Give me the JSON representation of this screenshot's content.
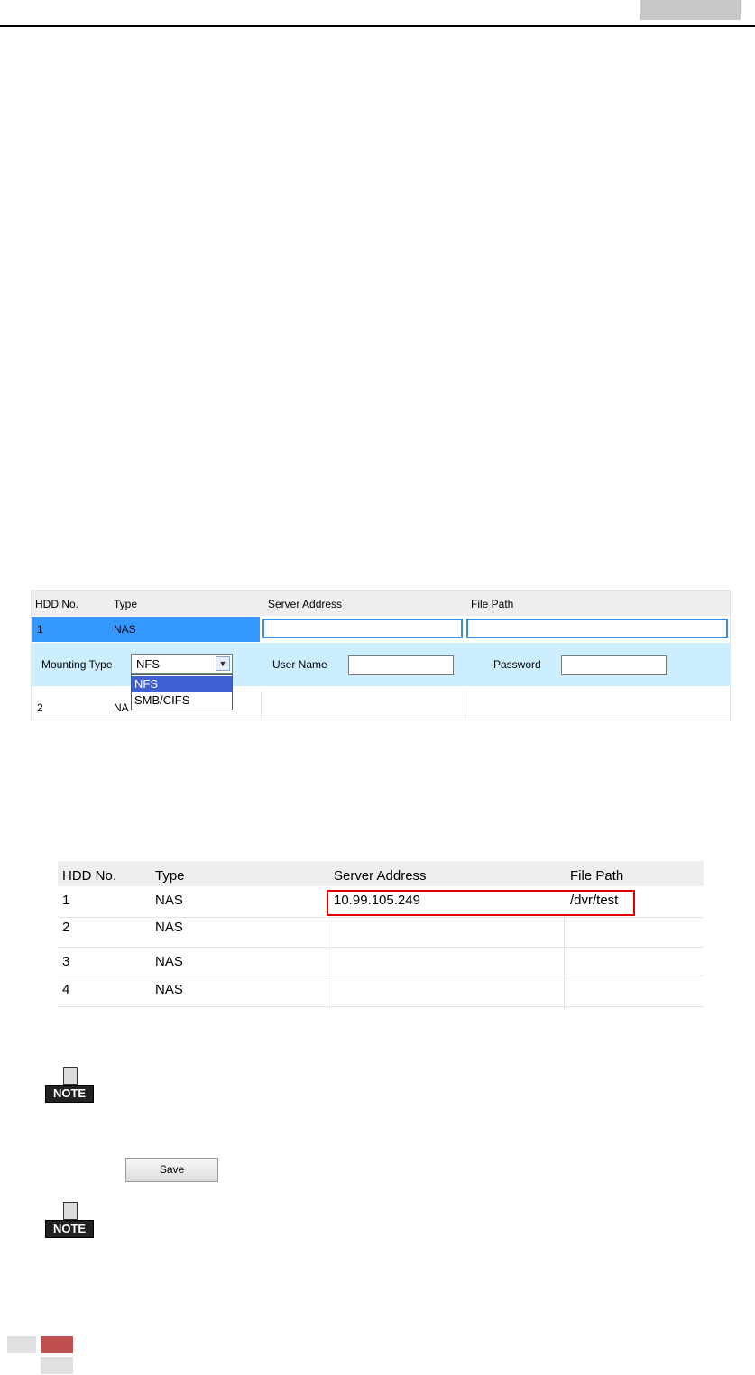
{
  "config_table": {
    "headers": [
      "HDD No.",
      "Type",
      "Server Address",
      "File Path"
    ],
    "selected_row": {
      "hdd_no": "1",
      "type": "NAS",
      "server_address": "",
      "file_path": ""
    },
    "mounting_type_label": "Mounting Type",
    "mounting_type_value": "NFS",
    "mounting_type_options": [
      "NFS",
      "SMB/CIFS"
    ],
    "user_name_label": "User Name",
    "user_name_value": "",
    "password_label": "Password",
    "password_value": "",
    "row2": {
      "hdd_no": "2",
      "type": "NA"
    }
  },
  "result_table": {
    "headers": [
      "HDD No.",
      "Type",
      "Server Address",
      "File Path"
    ],
    "rows": [
      {
        "hdd_no": "1",
        "type": "NAS",
        "server_address": "10.99.105.249",
        "file_path": "/dvr/test"
      },
      {
        "hdd_no": "2",
        "type": "NAS",
        "server_address": "",
        "file_path": ""
      },
      {
        "hdd_no": "3",
        "type": "NAS",
        "server_address": "",
        "file_path": ""
      },
      {
        "hdd_no": "4",
        "type": "NAS",
        "server_address": "",
        "file_path": ""
      }
    ]
  },
  "note_label": "NOTE",
  "save_label": "Save",
  "colors": {
    "selection_blue": "#3399ff",
    "panel_light_blue": "#cceeff",
    "highlight_red": "#e00000",
    "footer_red": "#c0504d"
  }
}
